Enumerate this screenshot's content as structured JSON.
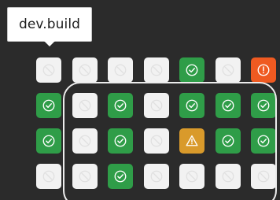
{
  "tooltip": {
    "text": "dev.build"
  },
  "status_colors": {
    "passed": "#2f9d48",
    "skipped": "#f2f2f2",
    "warning": "#d99a2b",
    "failed": "#ef5a21"
  },
  "grid": {
    "rows": [
      [
        "skipped",
        "skipped",
        "skipped",
        "skipped",
        "passed",
        "skipped",
        "failed"
      ],
      [
        "passed",
        "skipped",
        "passed",
        "skipped",
        "passed",
        "passed",
        "passed"
      ],
      [
        "passed",
        "skipped",
        "passed",
        "skipped",
        "warning",
        "passed",
        "passed"
      ],
      [
        "skipped",
        "skipped",
        "passed",
        "skipped",
        "skipped",
        "skipped",
        "skipped"
      ]
    ]
  }
}
